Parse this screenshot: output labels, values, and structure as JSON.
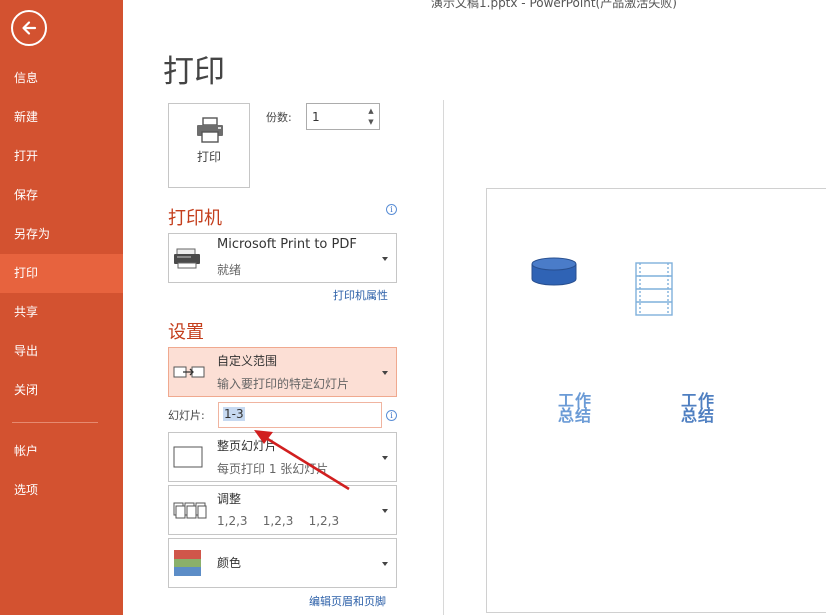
{
  "window": {
    "title": "演示文稿1.pptx - PowerPoint(产品激活失败)"
  },
  "sidebar": {
    "items": [
      {
        "label": "信息"
      },
      {
        "label": "新建"
      },
      {
        "label": "打开"
      },
      {
        "label": "保存"
      },
      {
        "label": "另存为"
      },
      {
        "label": "打印",
        "active": true
      },
      {
        "label": "共享"
      },
      {
        "label": "导出"
      },
      {
        "label": "关闭"
      },
      {
        "label": "帐户"
      },
      {
        "label": "选项"
      }
    ],
    "back_icon": "back-arrow-icon"
  },
  "page": {
    "title": "打印"
  },
  "print": {
    "button_label": "打印",
    "copies_label": "份数:",
    "copies_value": "1"
  },
  "printer": {
    "section_title": "打印机",
    "name": "Microsoft Print to PDF",
    "status": "就绪",
    "properties_link": "打印机属性"
  },
  "settings": {
    "section_title": "设置",
    "range": {
      "main": "自定义范围",
      "sub": "输入要打印的特定幻灯片"
    },
    "slides_label": "幻灯片:",
    "slides_value": "1-3",
    "layout": {
      "main": "整页幻灯片",
      "sub": "每页打印 1 张幻灯片"
    },
    "collate": {
      "main": "调整",
      "sub": "1,2,3    1,2,3    1,2,3"
    },
    "color": {
      "main": "颜色"
    },
    "header_footer_link": "编辑页眉和页脚"
  },
  "preview": {
    "texts": [
      "工作\n总结",
      "工作\n总结"
    ]
  },
  "colors": {
    "sidebar_bg": "#d35230",
    "sidebar_active": "#e7633e",
    "accent_title": "#c43e1c",
    "highlight_bg": "#fcdfd5",
    "link": "#2b5fa8",
    "annotation_arrow": "#d11f1f"
  }
}
